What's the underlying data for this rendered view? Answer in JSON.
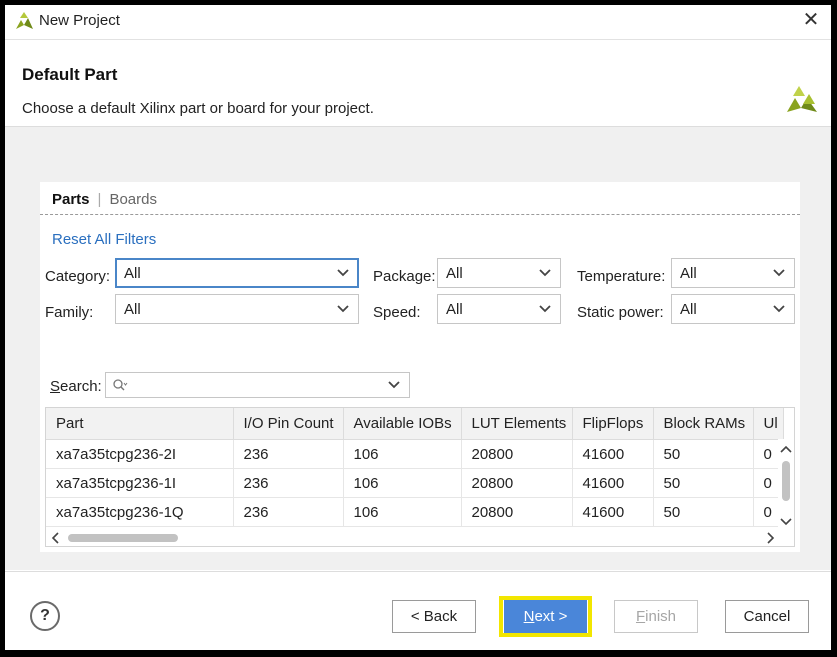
{
  "window": {
    "title": "New Project",
    "close_glyph": "✕"
  },
  "header": {
    "title": "Default Part",
    "description": "Choose a default Xilinx part or board for your project."
  },
  "tabs": {
    "parts": "Parts",
    "separator": "|",
    "boards": "Boards"
  },
  "filters": {
    "reset_label": "Reset All Filters",
    "category": {
      "label": "Category:",
      "value": "All"
    },
    "family": {
      "label": "Family:",
      "value": "All"
    },
    "package": {
      "label": "Package:",
      "value": "All"
    },
    "speed": {
      "label": "Speed:",
      "value": "All"
    },
    "temperature": {
      "label": "Temperature:",
      "value": "All"
    },
    "static_power": {
      "label": "Static power:",
      "value": "All"
    }
  },
  "search": {
    "label_first": "S",
    "label_rest": "earch:",
    "placeholder": ""
  },
  "table": {
    "columns": [
      "Part",
      "I/O Pin Count",
      "Available IOBs",
      "LUT Elements",
      "FlipFlops",
      "Block RAMs",
      "Ul"
    ],
    "rows": [
      [
        "xa7a35tcpg236-2I",
        "236",
        "106",
        "20800",
        "41600",
        "50",
        "0"
      ],
      [
        "xa7a35tcpg236-1I",
        "236",
        "106",
        "20800",
        "41600",
        "50",
        "0"
      ],
      [
        "xa7a35tcpg236-1Q",
        "236",
        "106",
        "20800",
        "41600",
        "50",
        "0"
      ]
    ]
  },
  "footer": {
    "help": "?",
    "back": "< Back",
    "next_first": "N",
    "next_rest": "ext >",
    "finish_first": "F",
    "finish_rest": "inish",
    "cancel": "Cancel"
  },
  "colors": {
    "accent": "#4a86d9",
    "highlight": "#f2e600",
    "link": "#2a6fbf",
    "logo": "#9fb82a"
  },
  "icons": [
    "xilinx-logo-icon",
    "close-icon",
    "chevron-down-icon",
    "search-icon",
    "help-icon"
  ]
}
